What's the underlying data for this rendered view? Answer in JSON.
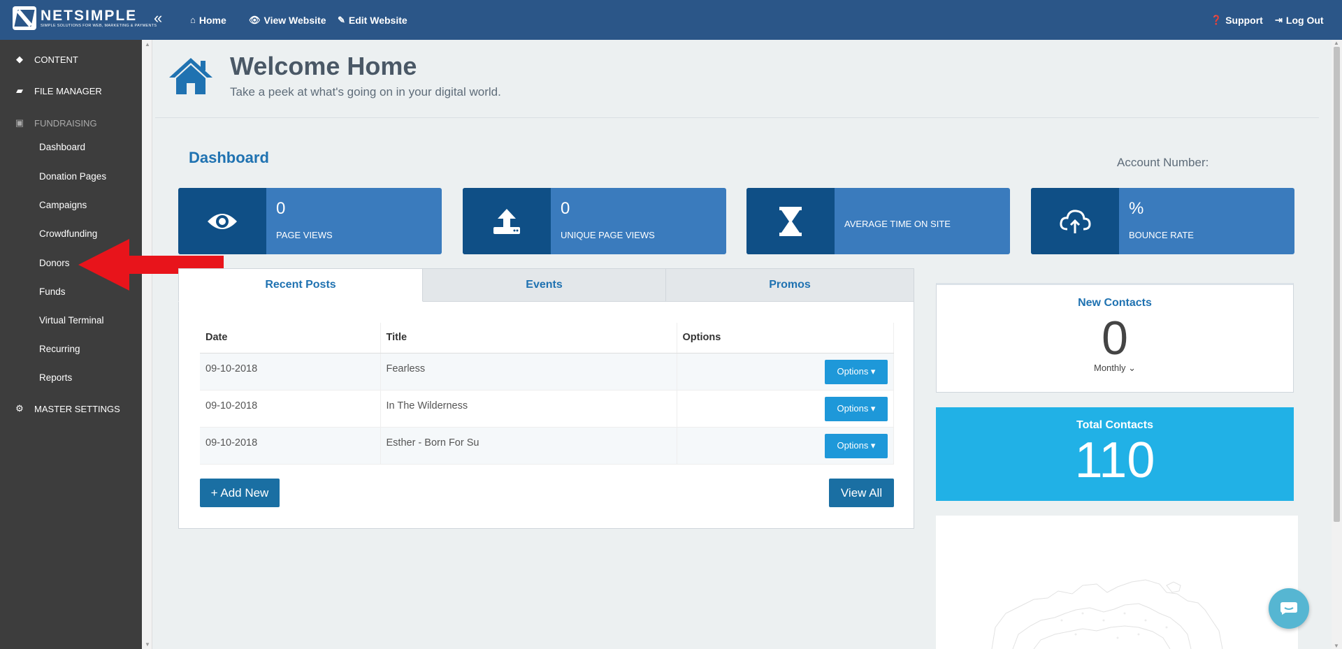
{
  "brand": {
    "name": "NETSIMPLE",
    "tagline": "SIMPLE SOLUTIONS FOR WEB, MARKETING & PAYMENTS"
  },
  "topnav": {
    "collapse_icon": "«",
    "home": "Home",
    "view_website": "View Website",
    "edit_website": "Edit Website",
    "support": "Support",
    "logout": "Log Out"
  },
  "sidebar": {
    "sections": [
      {
        "label": "CONTENT",
        "icon": "diamond-icon"
      },
      {
        "label": "FILE MANAGER",
        "icon": "folder-icon"
      },
      {
        "label": "FUNDRAISING",
        "icon": "money-icon"
      },
      {
        "label": "MASTER SETTINGS",
        "icon": "gear-icon"
      }
    ],
    "fundraising_items": [
      "Dashboard",
      "Donation Pages",
      "Campaigns",
      "Crowdfunding",
      "Donors",
      "Funds",
      "Virtual Terminal",
      "Recurring",
      "Reports"
    ]
  },
  "header": {
    "title": "Welcome Home",
    "subtitle": "Take a peek at what's going on in your digital world."
  },
  "dashboard": {
    "title": "Dashboard",
    "account_label": "Account Number:",
    "stats": [
      {
        "value": "0",
        "label": "PAGE VIEWS",
        "icon": "eye-icon"
      },
      {
        "value": "0",
        "label": "UNIQUE PAGE VIEWS",
        "icon": "upload-icon"
      },
      {
        "value": "",
        "label": "AVERAGE TIME ON SITE",
        "icon": "hourglass-icon"
      },
      {
        "value": "%",
        "label": "BOUNCE RATE",
        "icon": "cloud-upload-icon"
      }
    ]
  },
  "tabs": [
    "Recent Posts",
    "Events",
    "Promos"
  ],
  "posts_table": {
    "headers": [
      "Date",
      "Title",
      "Options"
    ],
    "rows": [
      {
        "date": "09-10-2018",
        "title": "Fearless",
        "option": "Options ▾"
      },
      {
        "date": "09-10-2018",
        "title": "In The Wilderness",
        "option": "Options ▾"
      },
      {
        "date": "09-10-2018",
        "title": "Esther - Born For Su",
        "option": "Options ▾"
      }
    ],
    "add_new": "+ Add New",
    "view_all": "View All"
  },
  "new_contacts": {
    "title": "New Contacts",
    "value": "0",
    "period": "Monthly ⌄"
  },
  "total_contacts": {
    "title": "Total Contacts",
    "value": "110"
  },
  "colors": {
    "topbar": "#2b5688",
    "sidebar": "#3d3d3d",
    "stat_bg": "#3a7bbd",
    "stat_icon_bg": "#0f4f86",
    "accent": "#1f72b1",
    "total_card": "#21b1e6",
    "arrow": "#e8141b"
  }
}
